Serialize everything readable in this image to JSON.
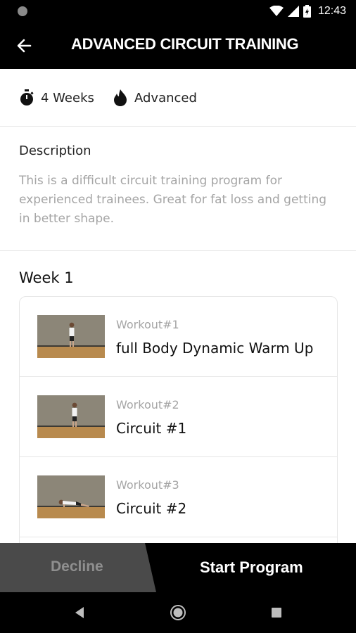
{
  "status": {
    "time": "12:43"
  },
  "header": {
    "title": "ADVANCED CIRCUIT TRAINING"
  },
  "meta": {
    "duration": "4 Weeks",
    "level": "Advanced"
  },
  "description": {
    "title": "Description",
    "body": "This is a difficult circuit training program for experienced trainees. Great for fat loss and getting in better shape."
  },
  "week": {
    "title": "Week 1",
    "workouts": [
      {
        "label": "Workout#1",
        "name": "full Body Dynamic Warm Up"
      },
      {
        "label": "Workout#2",
        "name": "Circuit #1"
      },
      {
        "label": "Workout#3",
        "name": "Circuit #2"
      }
    ]
  },
  "actions": {
    "decline": "Decline",
    "start": "Start Program"
  },
  "colors": {
    "bar": "#000000",
    "decline_bg": "#4a4a4a",
    "muted": "#a5a5a5"
  },
  "icons": [
    "back-arrow-icon",
    "stopwatch-icon",
    "flame-icon",
    "wifi-icon",
    "signal-icon",
    "battery-icon",
    "nav-back-icon",
    "nav-home-icon",
    "nav-recents-icon"
  ]
}
